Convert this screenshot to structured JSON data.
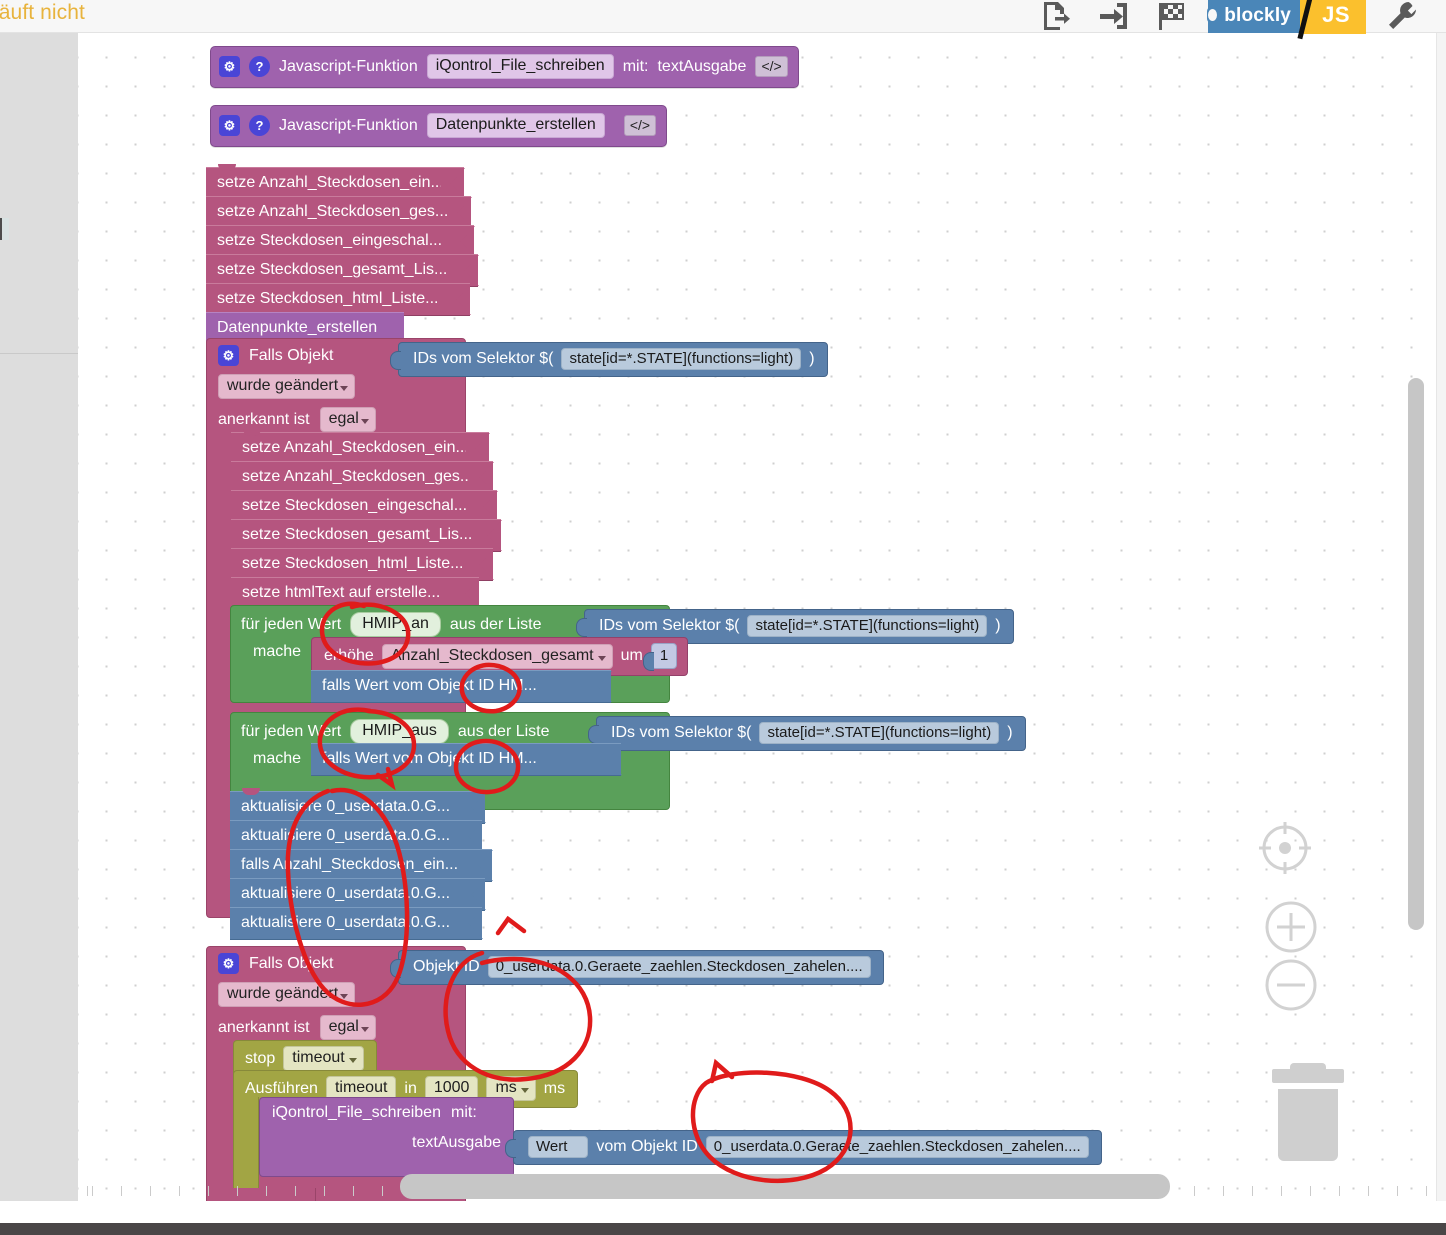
{
  "header": {
    "title": "läuft nicht",
    "title_color": "#e8b33c",
    "toolbar": [
      {
        "name": "export-file-icon",
        "label": "Export"
      },
      {
        "name": "import-file-icon",
        "label": "Import"
      },
      {
        "name": "checkered-flag-icon",
        "label": "Start"
      },
      {
        "name": "blockly-js-toggle",
        "label_left": "blockly",
        "label_right": "JS"
      },
      {
        "name": "wrench-icon",
        "label": "Einstellungen"
      }
    ]
  },
  "functions": [
    {
      "keyword": "Javascript-Funktion",
      "name": "iQontrol_File_schreiben",
      "with_label": "mit:",
      "param": "textAusgabe",
      "code_badge": "</>"
    },
    {
      "keyword": "Javascript-Funktion",
      "name": "Datenpunkte_erstellen",
      "with_label": "",
      "param": "",
      "code_badge": "</>"
    }
  ],
  "top_stack": {
    "setze_blocks": [
      "setze Anzahl_Steckdosen_ein...",
      "setze Anzahl_Steckdosen_ges...",
      "setze Steckdosen_eingeschal...",
      "setze Steckdosen_gesamt_Lis...",
      "setze Steckdosen_html_Liste..."
    ],
    "call_block": "Datenpunkte_erstellen"
  },
  "trigger_one": {
    "title": "Falls Objekt",
    "change_dropdown": "wurde geändert",
    "ack_label": "anerkannt ist",
    "ack_dropdown": "egal",
    "selector": {
      "prefix": "IDs vom Selektor $(",
      "value": "state[id=*.STATE](functions=light)",
      "suffix": ")"
    },
    "setze_blocks": [
      "setze Anzahl_Steckdosen_ein...",
      "setze Anzahl_Steckdosen_ges...",
      "setze Steckdosen_eingeschal...",
      "setze Steckdosen_gesamt_Lis...",
      "setze Steckdosen_html_Liste...",
      "setze htmlText auf erstelle..."
    ],
    "loops": [
      {
        "prefix": "für jeden Wert",
        "var": "HMIP_an",
        "middle": "aus der Liste",
        "selector_prefix": "IDs vom Selektor $(",
        "selector_value": "state[id=*.STATE](functions=light)",
        "selector_suffix": ")",
        "do_label": "mache",
        "body": [
          {
            "kind": "increment",
            "prefix": "erhöhe",
            "var": "Anzahl_Steckdosen_gesamt",
            "by_label": "um",
            "amount": "1"
          },
          {
            "kind": "blue",
            "text": "falls Wert vom Objekt ID HM..."
          }
        ]
      },
      {
        "prefix": "für jeden Wert",
        "var": "HMIP_aus",
        "middle": "aus der Liste",
        "selector_prefix": "IDs vom Selektor $(",
        "selector_value": "state[id=*.STATE](functions=light)",
        "selector_suffix": ")",
        "do_label": "mache",
        "body": [
          {
            "kind": "blue",
            "text": "falls Wert vom Objekt ID HM..."
          }
        ]
      }
    ],
    "update_blocks": [
      "aktualisiere 0_userdata.0.G...",
      "aktualisiere 0_userdata.0.G...",
      "falls Anzahl_Steckdosen_ein...",
      "aktualisiere 0_userdata.0.G...",
      "aktualisiere 0_userdata.0.G..."
    ]
  },
  "trigger_two": {
    "title": "Falls Objekt",
    "change_dropdown": "wurde geändert",
    "ack_label": "anerkannt ist",
    "ack_dropdown": "egal",
    "objekt_id_label": "Objekt ID",
    "objekt_id_value": "0_userdata.0.Geraete_zaehlen.Steckdosen_zahelen....",
    "stop_label": "stop",
    "stop_dropdown": "timeout",
    "run_label": "Ausführen",
    "run_dropdown": "timeout",
    "run_in_label": "in",
    "run_delay": "1000",
    "run_unit_dropdown": "ms",
    "run_unit_suffix": "ms",
    "call_name": "iQontrol_File_schreiben",
    "call_with": "mit:",
    "call_param": "textAusgabe",
    "value_dropdown": "Wert",
    "value_prefix": "vom Objekt ID",
    "value_id": "0_userdata.0.Geraete_zaehlen.Steckdosen_zahelen...."
  },
  "controls": {
    "center_icon": "crosshair-target-icon",
    "zoom_in_icon": "zoom-in-icon",
    "zoom_out_icon": "zoom-out-icon",
    "trash_icon": "trash-can-icon"
  },
  "colors": {
    "function_purple": "#9f62ad",
    "statement_pink": "#b5557f",
    "value_blue": "#5b80ab",
    "loop_green": "#5aa05a",
    "timeout_olive": "#a2a544",
    "annotation_red": "#e01b1b",
    "header_amber": "#e8b33c"
  }
}
